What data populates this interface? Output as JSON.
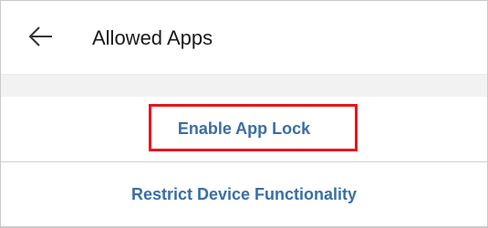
{
  "header": {
    "back_icon": "arrow-left-icon",
    "title": "Allowed Apps"
  },
  "actions": [
    {
      "label": "Enable App Lock",
      "highlighted": true,
      "highlight_color": "#e8151b"
    },
    {
      "label": "Restrict Device Functionality",
      "highlighted": false
    }
  ],
  "colors": {
    "link": "#3a6ea5",
    "band": "#f2f2f2"
  }
}
